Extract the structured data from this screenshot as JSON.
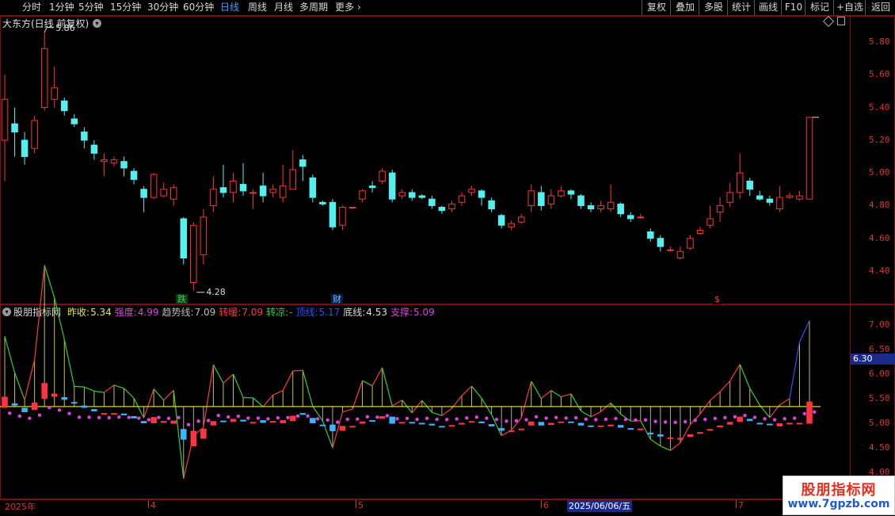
{
  "toolbar": {
    "periods": [
      "分时",
      "1分钟",
      "5分钟",
      "15分钟",
      "30分钟",
      "60分钟",
      "日线",
      "周线",
      "月线",
      "多周期",
      "更多"
    ],
    "active_period": "日线",
    "right_buttons": [
      "复权",
      "叠加",
      "多股",
      "统计",
      "画线",
      "F10",
      "标记",
      "+自选",
      "返回"
    ]
  },
  "main_panel": {
    "title": "大东方(日线 前复权)",
    "high_label": "5.86",
    "low_label": "4.28",
    "y_ticks": [
      "5.80",
      "5.60",
      "5.40",
      "5.20",
      "5.00",
      "4.80",
      "4.60",
      "4.40"
    ],
    "markers": [
      {
        "text": "跌",
        "color": "#3cd04a",
        "bg": "#0b3b14"
      },
      {
        "text": "财",
        "color": "#6fb8ff",
        "bg": "#0a1e4a"
      },
      {
        "text": "$",
        "color": "#ff3a3a",
        "bg": "#000000"
      }
    ]
  },
  "indicator_panel": {
    "title": "股朋指标网",
    "items": [
      {
        "label": "昨收:",
        "value": "5.34",
        "color": "#e8e84a"
      },
      {
        "label": "强度:",
        "value": "4.99",
        "color": "#e040e0"
      },
      {
        "label": "趋势线:",
        "value": "7.09",
        "color": "#bbbbbb"
      },
      {
        "label": "转暖:",
        "value": "7.09",
        "color": "#ff3a3a"
      },
      {
        "label": "转凉:",
        "value": "-",
        "color": "#33d033"
      },
      {
        "label": "顶线:",
        "value": "5.17",
        "color": "#3050ff"
      },
      {
        "label": "底线:",
        "value": "4.53",
        "color": "#dddddd"
      },
      {
        "label": "支撑:",
        "value": "5.09",
        "color": "#e040e0"
      }
    ],
    "y_ticks": [
      "7.00",
      "6.50",
      "6.00",
      "5.50",
      "5.00",
      "4.50",
      "4.00"
    ],
    "current_value": "6.30"
  },
  "date_axis": {
    "labels": [
      "2025年",
      "4",
      "5",
      "6",
      "7"
    ],
    "highlight": "2025/06/06/五"
  },
  "watermark": {
    "title": "股朋指标网",
    "url": "www.7gpzb.com"
  },
  "colors": {
    "up": "#ff3333",
    "down": "#54f0f0",
    "border": "#7a1010",
    "axis": "#dd3333"
  },
  "chart_data": {
    "type": "candlestick",
    "title": "大东方(日线 前复权)",
    "price_range": [
      4.2,
      5.95
    ],
    "indicator_range": [
      4.0,
      7.2
    ],
    "prev_close_line": 5.34,
    "candles": [
      [
        5.2,
        5.45,
        4.95,
        5.6
      ],
      [
        5.3,
        5.25,
        5.1,
        5.4
      ],
      [
        5.2,
        5.1,
        5.05,
        5.25
      ],
      [
        5.15,
        5.32,
        5.12,
        5.35
      ],
      [
        5.4,
        5.76,
        5.38,
        5.86
      ],
      [
        5.45,
        5.52,
        5.4,
        5.65
      ],
      [
        5.44,
        5.38,
        5.35,
        5.46
      ],
      [
        5.33,
        5.3,
        5.28,
        5.36
      ],
      [
        5.25,
        5.2,
        5.15,
        5.28
      ],
      [
        5.17,
        5.12,
        5.08,
        5.2
      ],
      [
        5.07,
        5.08,
        4.98,
        5.12
      ],
      [
        5.06,
        5.08,
        5.04,
        5.1
      ],
      [
        5.07,
        5.03,
        4.98,
        5.1
      ],
      [
        5.01,
        4.96,
        4.93,
        5.03
      ],
      [
        4.9,
        4.85,
        4.76,
        4.92
      ],
      [
        4.85,
        4.99,
        4.84,
        5.0
      ],
      [
        4.86,
        4.9,
        4.85,
        4.94
      ],
      [
        4.84,
        4.91,
        4.8,
        4.93
      ],
      [
        4.72,
        4.48,
        4.44,
        4.73
      ],
      [
        4.33,
        4.68,
        4.28,
        4.7
      ],
      [
        4.5,
        4.73,
        4.44,
        4.78
      ],
      [
        4.8,
        4.9,
        4.76,
        4.98
      ],
      [
        4.91,
        4.88,
        4.85,
        5.05
      ],
      [
        4.88,
        4.95,
        4.82,
        5.0
      ],
      [
        4.93,
        4.89,
        4.86,
        5.06
      ],
      [
        4.88,
        4.88,
        4.78,
        4.9
      ],
      [
        4.92,
        4.86,
        4.82,
        5.0
      ],
      [
        4.88,
        4.9,
        4.85,
        4.93
      ],
      [
        4.85,
        4.92,
        4.82,
        5.05
      ],
      [
        4.9,
        5.02,
        4.9,
        5.14
      ],
      [
        5.08,
        5.04,
        4.95,
        5.11
      ],
      [
        4.97,
        4.85,
        4.82,
        4.99
      ],
      [
        4.82,
        4.81,
        4.8,
        4.83
      ],
      [
        4.82,
        4.67,
        4.65,
        4.84
      ],
      [
        4.68,
        4.79,
        4.65,
        4.8
      ],
      [
        4.79,
        4.79,
        4.79,
        4.79
      ],
      [
        4.84,
        4.89,
        4.82,
        4.9
      ],
      [
        4.92,
        4.91,
        4.88,
        4.95
      ],
      [
        4.95,
        5.01,
        4.93,
        5.03
      ],
      [
        5.0,
        4.84,
        4.82,
        5.02
      ],
      [
        4.86,
        4.88,
        4.84,
        4.9
      ],
      [
        4.88,
        4.85,
        4.83,
        4.9
      ],
      [
        4.86,
        4.85,
        4.84,
        4.87
      ],
      [
        4.84,
        4.8,
        4.78,
        4.86
      ],
      [
        4.79,
        4.77,
        4.75,
        4.8
      ],
      [
        4.78,
        4.81,
        4.76,
        4.83
      ],
      [
        4.82,
        4.86,
        4.8,
        4.88
      ],
      [
        4.88,
        4.9,
        4.86,
        4.92
      ],
      [
        4.89,
        4.85,
        4.8,
        4.9
      ],
      [
        4.83,
        4.78,
        4.76,
        4.85
      ],
      [
        4.74,
        4.68,
        4.66,
        4.75
      ],
      [
        4.67,
        4.69,
        4.65,
        4.71
      ],
      [
        4.7,
        4.73,
        4.69,
        4.75
      ],
      [
        4.8,
        4.89,
        4.76,
        4.93
      ],
      [
        4.88,
        4.8,
        4.77,
        4.92
      ],
      [
        4.81,
        4.86,
        4.78,
        4.9
      ],
      [
        4.86,
        4.89,
        4.85,
        4.92
      ],
      [
        4.89,
        4.87,
        4.84,
        4.9
      ],
      [
        4.86,
        4.8,
        4.78,
        4.87
      ],
      [
        4.8,
        4.78,
        4.76,
        4.82
      ],
      [
        4.78,
        4.8,
        4.76,
        4.83
      ],
      [
        4.78,
        4.82,
        4.76,
        4.93
      ],
      [
        4.81,
        4.75,
        4.73,
        4.82
      ],
      [
        4.74,
        4.72,
        4.7,
        4.76
      ],
      [
        4.73,
        4.73,
        4.72,
        4.75
      ],
      [
        4.64,
        4.6,
        4.58,
        4.66
      ],
      [
        4.6,
        4.55,
        4.52,
        4.62
      ],
      [
        4.53,
        4.53,
        4.52,
        4.55
      ],
      [
        4.48,
        4.52,
        4.47,
        4.55
      ],
      [
        4.54,
        4.6,
        4.53,
        4.62
      ],
      [
        4.63,
        4.65,
        4.62,
        4.67
      ],
      [
        4.68,
        4.72,
        4.66,
        4.8
      ],
      [
        4.76,
        4.8,
        4.7,
        4.85
      ],
      [
        4.82,
        4.88,
        4.79,
        4.94
      ],
      [
        4.88,
        5.0,
        4.84,
        5.12
      ],
      [
        4.95,
        4.9,
        4.86,
        4.97
      ],
      [
        4.86,
        4.84,
        4.83,
        4.89
      ],
      [
        4.84,
        4.82,
        4.8,
        4.86
      ],
      [
        4.78,
        4.85,
        4.76,
        4.92
      ],
      [
        4.85,
        4.86,
        4.84,
        4.88
      ],
      [
        4.84,
        4.86,
        4.83,
        4.89
      ],
      [
        4.84,
        5.34,
        4.84,
        5.34
      ]
    ]
  }
}
